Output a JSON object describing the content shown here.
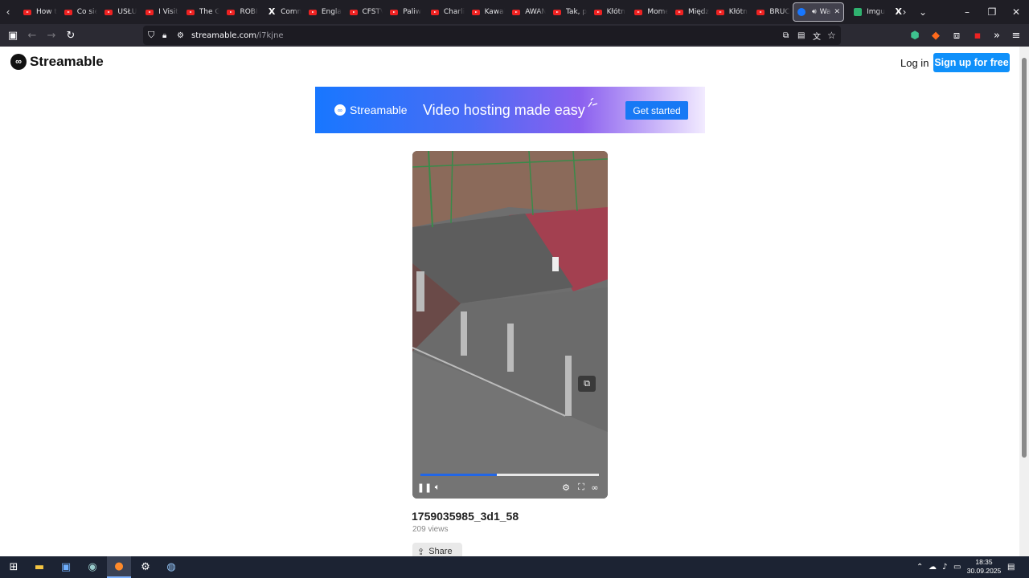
{
  "browser": {
    "tabs": [
      {
        "title": "How t",
        "icon": "youtube-icon"
      },
      {
        "title": "Co się",
        "icon": "youtube-icon"
      },
      {
        "title": "USŁU",
        "icon": "youtube-icon"
      },
      {
        "title": "I Visit",
        "icon": "youtube-icon"
      },
      {
        "title": "The G",
        "icon": "youtube-icon"
      },
      {
        "title": "ROBI",
        "icon": "youtube-icon"
      },
      {
        "title": "Comm",
        "icon": "x-icon"
      },
      {
        "title": "Engla",
        "icon": "youtube-icon"
      },
      {
        "title": "CFSTV",
        "icon": "youtube-icon"
      },
      {
        "title": "Paliw",
        "icon": "youtube-icon"
      },
      {
        "title": "Charli",
        "icon": "youtube-icon"
      },
      {
        "title": "Kawal",
        "icon": "youtube-icon"
      },
      {
        "title": "AWAN",
        "icon": "youtube-icon"
      },
      {
        "title": "Tak, p",
        "icon": "youtube-icon"
      },
      {
        "title": "Kłótn",
        "icon": "youtube-icon"
      },
      {
        "title": "Mome",
        "icon": "youtube-icon"
      },
      {
        "title": "Międz",
        "icon": "youtube-icon"
      },
      {
        "title": "Kłótn",
        "icon": "youtube-icon"
      },
      {
        "title": "BRUC",
        "icon": "youtube-icon"
      }
    ],
    "active_tab": {
      "title": "Wa",
      "icon": "streamable-icon"
    },
    "after_tabs": [
      {
        "title": "Imgu",
        "icon": "imgur-icon"
      },
      {
        "title": "",
        "icon": "x-icon"
      }
    ],
    "url_host": "streamable.com",
    "url_path": "/i7kjne"
  },
  "header": {
    "logo_text": "Streamable",
    "login_label": "Log in",
    "signup_label": "Sign up for free"
  },
  "banner": {
    "logo_text": "Streamable",
    "tagline": "Video hosting made easy",
    "cta_label": "Get started"
  },
  "video": {
    "progress_fraction": 0.43,
    "title": "1759035985_3d1_58",
    "views": "209 views",
    "share_label": "Share"
  },
  "taskbar": {
    "time": "18:35",
    "date": "30.09.2025"
  },
  "colors": {
    "accent": "#0f90fa",
    "tab_bar": "#1f1e25",
    "nav_bar": "#2b2a33",
    "progress": "#2166e6"
  }
}
